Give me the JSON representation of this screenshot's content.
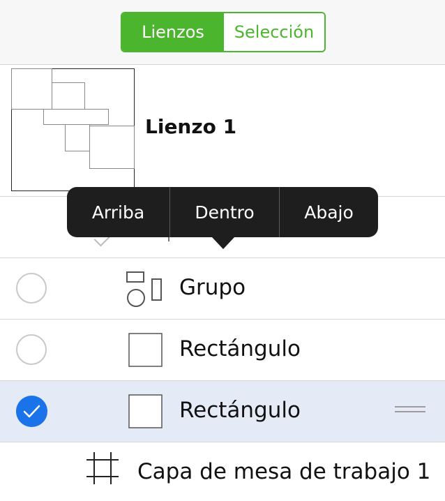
{
  "segmented": {
    "lienzos": "Lienzos",
    "seleccion": "Selección",
    "selected": "Lienzos"
  },
  "canvas": {
    "name": "Lienzo 1"
  },
  "popover": {
    "arriba": "Arriba",
    "dentro": "Dentro",
    "abajo": "Abajo"
  },
  "layers": [
    {
      "label": "Grupo",
      "icon": "group-shapes-icon",
      "checked": false
    },
    {
      "label": "Rectángulo",
      "icon": "rectangle-icon",
      "checked": false
    },
    {
      "label": "Rectángulo",
      "icon": "rectangle-icon",
      "checked": true
    }
  ],
  "artboard": {
    "label": "Capa de mesa de trabajo 1",
    "icon": "artboard-icon"
  },
  "colors": {
    "accent_green": "#4cb52e",
    "selection_blue": "#1a73e8",
    "selected_row": "#e4ebf7",
    "popover_bg": "#1e1e1e"
  }
}
